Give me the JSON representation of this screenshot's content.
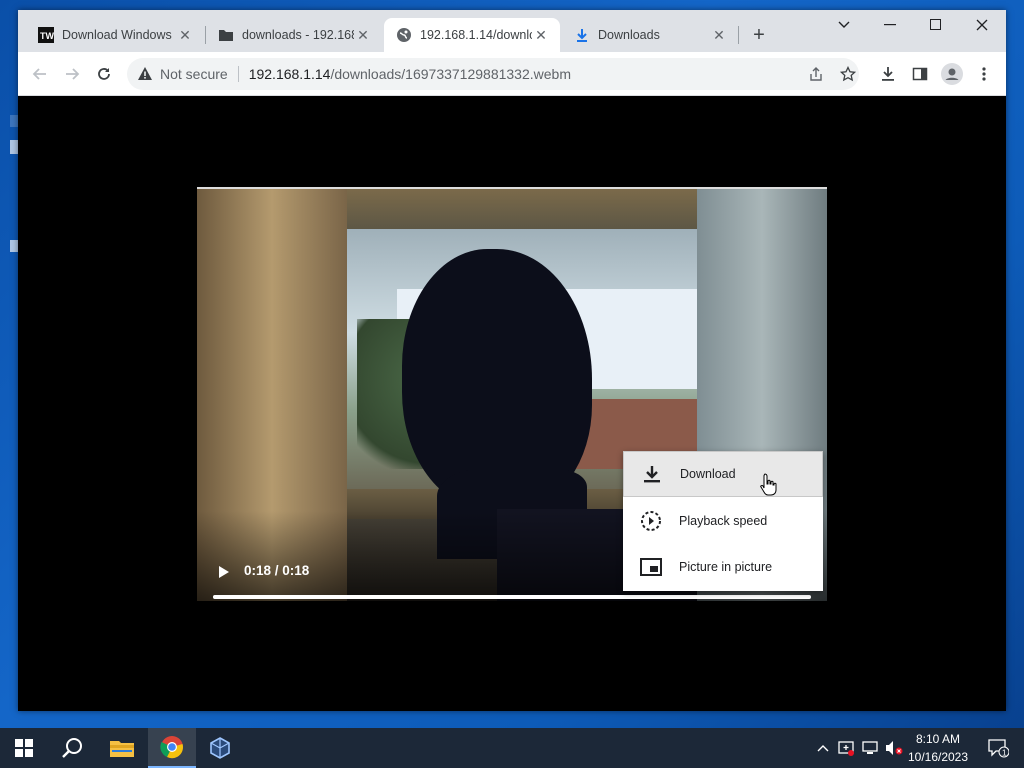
{
  "browser": {
    "tabs": [
      {
        "title": "Download Windows",
        "icon": "tenforums-icon",
        "active": false
      },
      {
        "title": "downloads - 192.168",
        "icon": "folder-icon",
        "active": false
      },
      {
        "title": "192.168.1.14/downlo",
        "icon": "globe-icon",
        "active": true
      },
      {
        "title": "Downloads",
        "icon": "download-icon",
        "active": false
      }
    ],
    "omnibox": {
      "security_label": "Not secure",
      "url_host": "192.168.1.14",
      "url_path": "/downloads/1697337129881332.webm"
    }
  },
  "video": {
    "time_display": "0:18 / 0:18",
    "progress": 1.0
  },
  "context_menu": {
    "items": [
      {
        "label": "Download",
        "icon": "download-icon",
        "hovered": true
      },
      {
        "label": "Playback speed",
        "icon": "playback-speed-icon",
        "hovered": false
      },
      {
        "label": "Picture in picture",
        "icon": "picture-in-picture-icon",
        "hovered": false
      }
    ]
  },
  "taskbar": {
    "clock_time": "8:10 AM",
    "clock_date": "10/16/2023",
    "notification_count": "1"
  },
  "colors": {
    "accent": "#1a73e8",
    "taskbar_bg": "#1c2838",
    "desktop_bg": "#0d5bb8"
  }
}
